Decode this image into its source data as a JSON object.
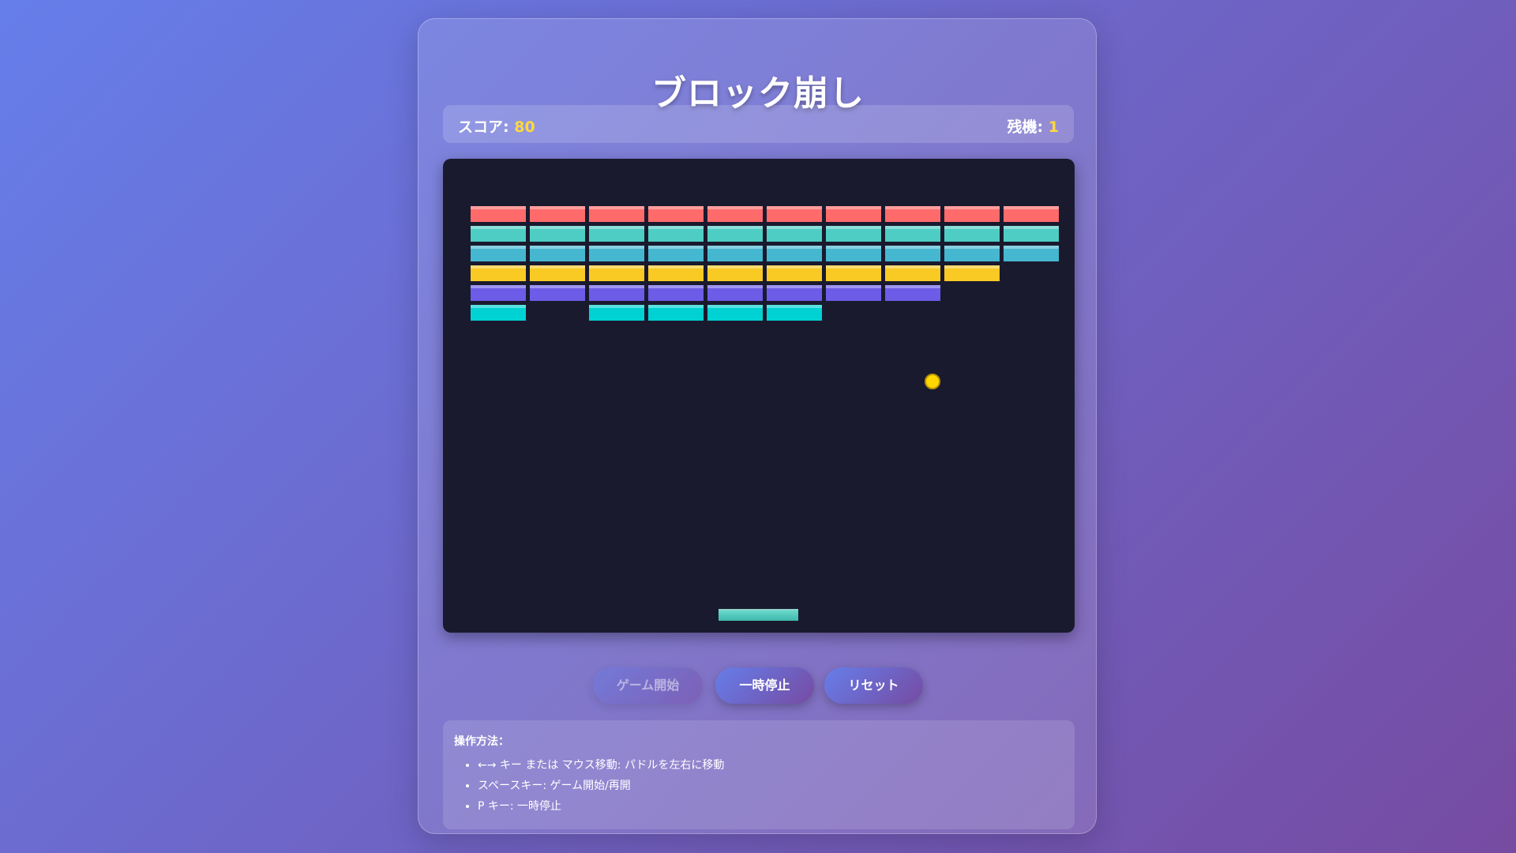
{
  "game": {
    "title": "ブロック崩し",
    "score_label": "スコア:",
    "score": "80",
    "lives_label": "残機:",
    "lives": "1"
  },
  "board": {
    "background": "#1a1a2e",
    "brick_colors": [
      "#ff6b6b",
      "#4ecdc4",
      "#45b7d1",
      "#f9ca24",
      "#6c5ce7",
      "#00d2d3"
    ],
    "brick_rows": [
      [
        1,
        1,
        1,
        1,
        1,
        1,
        1,
        1,
        1,
        1
      ],
      [
        1,
        1,
        1,
        1,
        1,
        1,
        1,
        1,
        1,
        1
      ],
      [
        1,
        1,
        1,
        1,
        1,
        1,
        1,
        1,
        1,
        1
      ],
      [
        1,
        1,
        1,
        1,
        1,
        1,
        1,
        1,
        1,
        0
      ],
      [
        1,
        1,
        1,
        1,
        1,
        1,
        1,
        1,
        0,
        0
      ],
      [
        1,
        0,
        1,
        1,
        1,
        1,
        0,
        0,
        0,
        0
      ]
    ],
    "ball_color": "#ffd700",
    "paddle_color": "#4ecdc4"
  },
  "controls": {
    "start_label": "ゲーム開始",
    "start_disabled": true,
    "pause_label": "一時停止",
    "reset_label": "リセット"
  },
  "help": {
    "title": "操作方法：",
    "items": [
      "←→ キー または マウス移動: パドルを左右に移動",
      "スペースキー: ゲーム開始/再開",
      "P キー: 一時停止"
    ]
  }
}
